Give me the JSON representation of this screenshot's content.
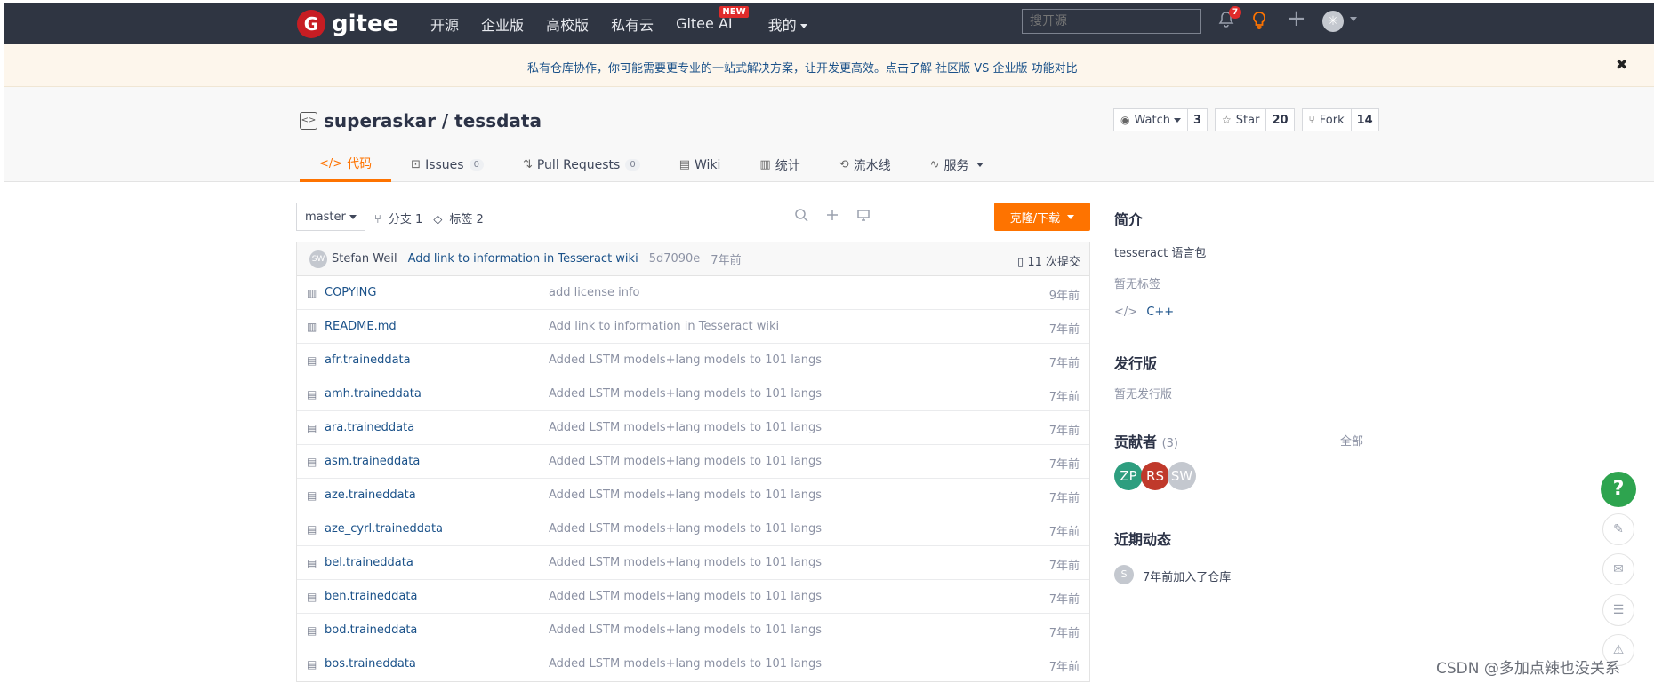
{
  "topnav": {
    "logo_letter": "G",
    "logo_text": "gitee",
    "links": [
      "开源",
      "企业版",
      "高校版",
      "私有云",
      "Gitee AI",
      "我的"
    ],
    "new_badge": "NEW",
    "search_placeholder": "搜开源",
    "notification_count": "7",
    "plus_label": "+",
    "avatar_glyph": "✳"
  },
  "banner": {
    "text": "私有仓库协作，你可能需要更专业的一站式解决方案，让开发更高效。点击了解 社区版 VS 企业版 功能对比",
    "close": "✖"
  },
  "repo": {
    "owner_repo": "superaskar / tessdata",
    "watch_label": "Watch",
    "watch_count": "3",
    "star_label": "Star",
    "star_count": "20",
    "fork_label": "Fork",
    "fork_count": "14"
  },
  "tabs": [
    {
      "label": "代码",
      "icon": "</>",
      "badge": ""
    },
    {
      "label": "Issues",
      "icon": "⊡",
      "badge": "0"
    },
    {
      "label": "Pull Requests",
      "icon": "⇅",
      "badge": "0"
    },
    {
      "label": "Wiki",
      "icon": "▤",
      "badge": ""
    },
    {
      "label": "统计",
      "icon": "▥",
      "badge": ""
    },
    {
      "label": "流水线",
      "icon": "⟲",
      "badge": ""
    },
    {
      "label": "服务",
      "icon": "∿",
      "badge": ""
    }
  ],
  "toolbar": {
    "branch": "master",
    "branches": "分支 1",
    "tags": "标签 2",
    "clone_label": "克隆/下载"
  },
  "commit": {
    "avatar": "SW",
    "author": "Stefan Weil",
    "message": "Add link to information in Tesseract wiki",
    "hash": "5d7090e",
    "time": "7年前",
    "count": "11 次提交"
  },
  "files": [
    {
      "name": "COPYING",
      "msg": "add license info",
      "time": "9年前",
      "icon": "book"
    },
    {
      "name": "README.md",
      "msg": "Add link to information in Tesseract wiki",
      "time": "7年前",
      "icon": "book"
    },
    {
      "name": "afr.traineddata",
      "msg": "Added LSTM models+lang models to 101 langs",
      "time": "7年前",
      "icon": "file"
    },
    {
      "name": "amh.traineddata",
      "msg": "Added LSTM models+lang models to 101 langs",
      "time": "7年前",
      "icon": "file"
    },
    {
      "name": "ara.traineddata",
      "msg": "Added LSTM models+lang models to 101 langs",
      "time": "7年前",
      "icon": "file"
    },
    {
      "name": "asm.traineddata",
      "msg": "Added LSTM models+lang models to 101 langs",
      "time": "7年前",
      "icon": "file"
    },
    {
      "name": "aze.traineddata",
      "msg": "Added LSTM models+lang models to 101 langs",
      "time": "7年前",
      "icon": "file"
    },
    {
      "name": "aze_cyrl.traineddata",
      "msg": "Added LSTM models+lang models to 101 langs",
      "time": "7年前",
      "icon": "file"
    },
    {
      "name": "bel.traineddata",
      "msg": "Added LSTM models+lang models to 101 langs",
      "time": "7年前",
      "icon": "file"
    },
    {
      "name": "ben.traineddata",
      "msg": "Added LSTM models+lang models to 101 langs",
      "time": "7年前",
      "icon": "file"
    },
    {
      "name": "bod.traineddata",
      "msg": "Added LSTM models+lang models to 101 langs",
      "time": "7年前",
      "icon": "file"
    },
    {
      "name": "bos.traineddata",
      "msg": "Added LSTM models+lang models to 101 langs",
      "time": "7年前",
      "icon": "file"
    }
  ],
  "sidebar": {
    "intro_title": "简介",
    "intro_text": "tesseract 语言包",
    "no_tags": "暂无标签",
    "language": "C++",
    "release_title": "发行版",
    "no_release": "暂无发行版",
    "contributors_title": "贡献者",
    "contributors_count": "(3)",
    "contributors_all": "全部",
    "contributors": [
      {
        "initials": "ZP",
        "color": "#2e9e7f"
      },
      {
        "initials": "RS",
        "color": "#c0392b"
      },
      {
        "initials": "SW",
        "color": "#c4c8cf"
      }
    ],
    "activity_title": "近期动态",
    "activity_avatar": "S",
    "activity_text": "7年前加入了仓库"
  },
  "floating": {
    "help": "?",
    "buttons": [
      "✎",
      "✉",
      "☰",
      "⚠"
    ]
  },
  "watermark": "CSDN @多加点辣也没关系",
  "colors": {
    "nav_bg": "#2f3542",
    "accent": "#fe7300",
    "link": "#1a5189",
    "help_green": "#2ea44f",
    "badge_red": "#e02b2b"
  }
}
